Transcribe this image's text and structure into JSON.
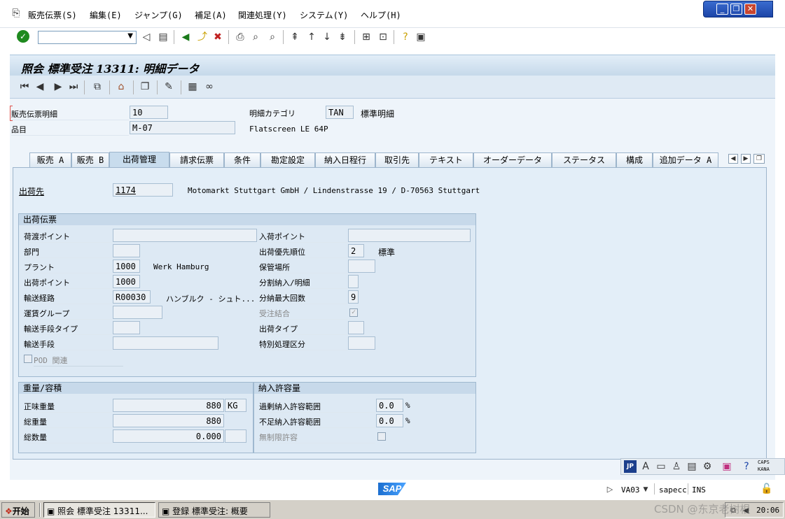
{
  "menu": {
    "items": [
      "販売伝票(S)",
      "編集(E)",
      "ジャンプ(G)",
      "補足(A)",
      "関連処理(Y)",
      "システム(Y)",
      "ヘルプ(H)"
    ]
  },
  "window_buttons": {
    "minimize": "_",
    "restore": "❐",
    "close": "✕"
  },
  "toolbar": {
    "command_value": ""
  },
  "title": "照会 標準受注 13311: 明細データ",
  "header": {
    "item_label": "販売伝票明細",
    "item_value": "10",
    "material_label": "品目",
    "material_value": "M-07",
    "category_label": "明細カテゴリ",
    "category_value": "TAN",
    "category_text": "標準明細",
    "material_desc": "Flatscreen LE 64P"
  },
  "tabs": [
    {
      "label": "販売 A"
    },
    {
      "label": "販売 B"
    },
    {
      "label": "出荷管理",
      "active": true
    },
    {
      "label": "請求伝票"
    },
    {
      "label": "条件"
    },
    {
      "label": "勘定設定"
    },
    {
      "label": "納入日程行"
    },
    {
      "label": "取引先"
    },
    {
      "label": "テキスト"
    },
    {
      "label": "オーダーデータ"
    },
    {
      "label": "ステータス"
    },
    {
      "label": "構成"
    },
    {
      "label": "追加データ A"
    }
  ],
  "shipto": {
    "label": "出荷先",
    "value": "1174",
    "desc": "Motomarkt Stuttgart GmbH / Lindenstrasse 19 / D-70563 Stuttgart"
  },
  "shipping": {
    "title": "出荷伝票",
    "left": [
      {
        "label": "荷渡ポイント",
        "value": ""
      },
      {
        "label": "部門",
        "value": ""
      },
      {
        "label": "プラント",
        "value": "1000",
        "desc": "Werk Hamburg"
      },
      {
        "label": "出荷ポイント",
        "value": "1000"
      },
      {
        "label": "輸送経路",
        "value": "R00030",
        "desc": "ハンブルク - シュト..."
      },
      {
        "label": "運賃グループ",
        "value": ""
      },
      {
        "label": "輸送手段タイプ",
        "value": ""
      },
      {
        "label": "輸送手段",
        "value": ""
      }
    ],
    "pod_label": "POD 関連",
    "right": [
      {
        "label": "入荷ポイント",
        "value": ""
      },
      {
        "label": "出荷優先順位",
        "value": "2",
        "desc": "標準"
      },
      {
        "label": "保管場所",
        "value": ""
      },
      {
        "label": "分割納入/明細",
        "value": ""
      },
      {
        "label": "分納最大回数",
        "value": "9"
      },
      {
        "label": "受注結合",
        "value": ""
      },
      {
        "label": "出荷タイプ",
        "value": ""
      },
      {
        "label": "特別処理区分",
        "value": ""
      }
    ]
  },
  "weights": {
    "title": "重量/容積",
    "net_label": "正味重量",
    "net_value": "880",
    "net_unit": "KG",
    "gross_label": "総重量",
    "gross_value": "880",
    "vol_label": "総数量",
    "vol_value": "0.000",
    "vol_unit": ""
  },
  "tolerance": {
    "title": "納入許容量",
    "over_label": "過剰納入許容範囲",
    "over_value": "0.0",
    "over_unit": "%",
    "under_label": "不足納入許容範囲",
    "under_value": "0.0",
    "under_unit": "%",
    "unlimited_label": "無制限許容"
  },
  "status": {
    "logo": "SAP",
    "tcode": "VA03",
    "server": "sapecc",
    "mode": "INS",
    "caps": "CAPS",
    "kana": "KANA"
  },
  "taskbar": {
    "start": "开始",
    "task1": "照会 標準受注 13311...",
    "task2": "登録 標準受注: 概要",
    "clock": "20:06",
    "watermark": "CSDN @东京老树根"
  },
  "colors": {
    "accent": "#1c45a8",
    "panel": "#e3eef8"
  }
}
